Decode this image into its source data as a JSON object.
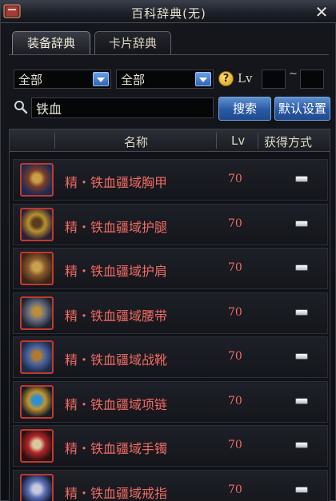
{
  "window": {
    "title": "百科辞典(无)"
  },
  "tabs": [
    {
      "label": "装备辞典"
    },
    {
      "label": "卡片辞典"
    }
  ],
  "filters": {
    "category1": "全部",
    "category2": "全部",
    "lv_label": "Lv",
    "lv_min": "",
    "lv_max": "",
    "lv_separator": "~"
  },
  "search": {
    "value": "铁血",
    "button": "搜索",
    "reset_button": "默认设置"
  },
  "table": {
    "headers": {
      "name": "名称",
      "lv": "Lv",
      "acquire": "获得方式"
    },
    "rows": [
      {
        "name": "精・铁血疆域胸甲",
        "lv": "70",
        "acquire": "—",
        "icon": "armor-chest-icon",
        "palette": [
          "#1a2a55",
          "#7a3c2a",
          "#c7a047"
        ]
      },
      {
        "name": "精・铁血疆域护腿",
        "lv": "70",
        "acquire": "—",
        "icon": "armor-legs-icon",
        "palette": [
          "#2a2035",
          "#b8912d",
          "#5a3a20"
        ]
      },
      {
        "name": "精・铁血疆域护肩",
        "lv": "70",
        "acquire": "—",
        "icon": "armor-shoulder-icon",
        "palette": [
          "#3a2418",
          "#8a5a2a",
          "#c9a050"
        ]
      },
      {
        "name": "精・铁血疆域腰带",
        "lv": "70",
        "acquire": "—",
        "icon": "armor-belt-icon",
        "palette": [
          "#1c2230",
          "#6a6f80",
          "#b98d3a"
        ]
      },
      {
        "name": "精・铁血疆域战靴",
        "lv": "70",
        "acquire": "—",
        "icon": "armor-boots-icon",
        "palette": [
          "#1e2a4a",
          "#4a66a0",
          "#b07a30"
        ]
      },
      {
        "name": "精・铁血疆域项链",
        "lv": "70",
        "acquire": "—",
        "icon": "necklace-icon",
        "palette": [
          "#181c28",
          "#c2952f",
          "#2f8fd0"
        ]
      },
      {
        "name": "精・铁血疆域手镯",
        "lv": "70",
        "acquire": "—",
        "icon": "bracelet-icon",
        "palette": [
          "#2a1010",
          "#b3262a",
          "#d8c8a0"
        ]
      },
      {
        "name": "精・铁血疆域戒指",
        "lv": "70",
        "acquire": "—",
        "icon": "ring-icon",
        "palette": [
          "#141a30",
          "#5a70b8",
          "#c8c8d8"
        ]
      }
    ]
  }
}
